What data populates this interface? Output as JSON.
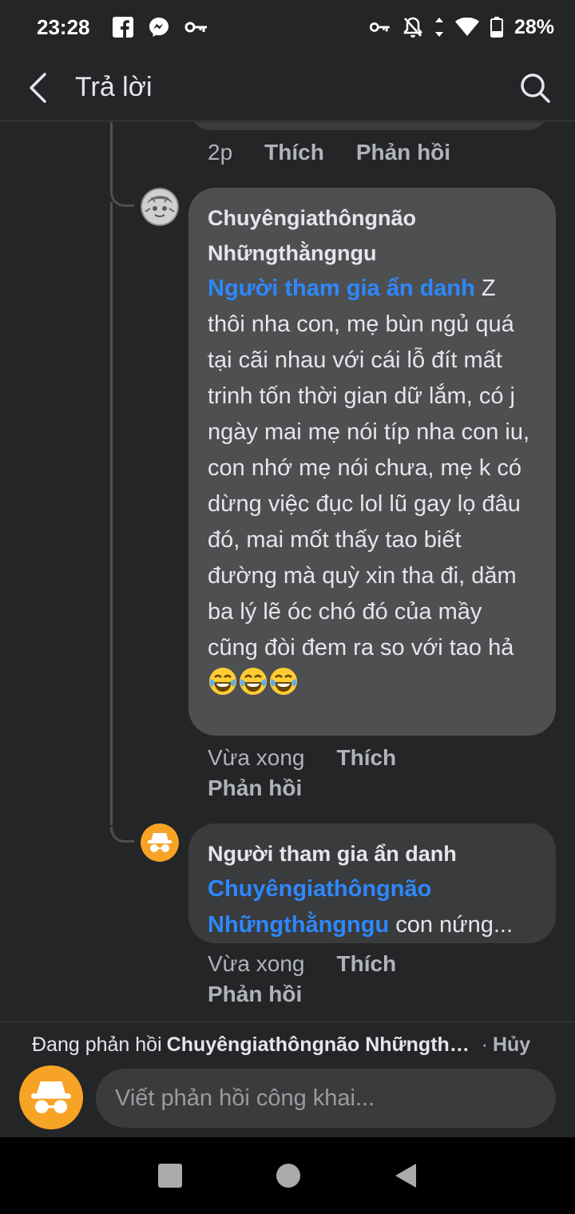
{
  "status_bar": {
    "time": "23:28",
    "battery": "28%"
  },
  "header": {
    "title": "Trả lời"
  },
  "previous_comment": {
    "time": "2p",
    "like": "Thích",
    "reply": "Phản hồi"
  },
  "comment1": {
    "author": "Chuyêngiathôngnão Nhữngthằngngu",
    "mention": "Người tham gia ẩn danh",
    "text": " Z thôi nha con, mẹ bùn ngủ quá tại cãi nhau với cái lỗ đít mất trinh tốn thời gian dữ lắm, có j ngày mai mẹ nói típ nha con iu, con nhớ mẹ nói chưa, mẹ k có dừng việc đục lol lũ gay lọ đâu đó, mai mốt thấy tao biết đường mà quỳ xin tha đi, dăm ba lý lẽ óc chó đó của mầy cũng đòi đem ra so với tao hả ",
    "emoji": "face-with-tears-of-joy",
    "time": "Vừa xong",
    "like": "Thích",
    "reply": "Phản hồi"
  },
  "comment2": {
    "author": "Người tham gia ẩn danh",
    "mention": "Chuyêngiathôngnão Nhữngthằngngu",
    "text": " con nứng...",
    "time": "Vừa xong",
    "like": "Thích",
    "reply": "Phản hồi"
  },
  "composer": {
    "replying_prefix": "Đang phản hồi",
    "replying_to": "Chuyêngiathôngnão Nhữngthằngngu",
    "separator": "·",
    "cancel": "Hủy",
    "placeholder": "Viết phản hồi công khai..."
  },
  "colors": {
    "background": "#242527",
    "bubble": "#3a3b3c",
    "highlighted_bubble": "#4e4f50",
    "mention": "#2d88ff",
    "anonymous_avatar": "#f7a325"
  }
}
